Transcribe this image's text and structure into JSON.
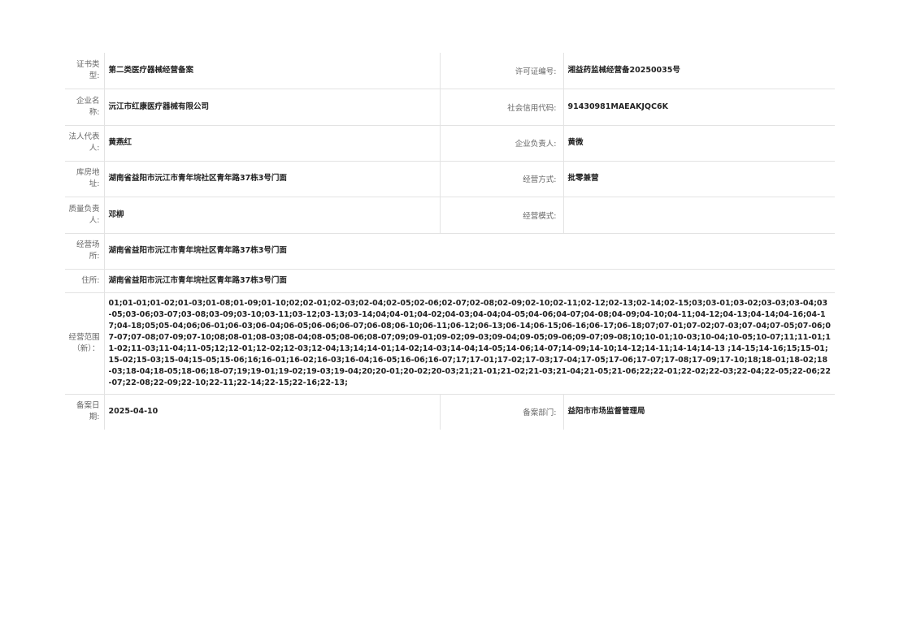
{
  "record": {
    "cert_type": {
      "label": "证书类型:",
      "value": "第二类医疗器械经营备案"
    },
    "license_no": {
      "label": "许可证编号:",
      "value": "湘益药监械经营备20250035号"
    },
    "company_name": {
      "label": "企业名称:",
      "value": "沅江市红康医疗器械有限公司"
    },
    "credit_code": {
      "label": "社会信用代码:",
      "value": "91430981MAEAKJQC6K"
    },
    "legal_rep": {
      "label": "法人代表人:",
      "value": "黄燕红"
    },
    "principal": {
      "label": "企业负责人:",
      "value": "黄微"
    },
    "warehouse": {
      "label": "库房地址:",
      "value": "湖南省益阳市沅江市青年垸社区青年路37栋3号门面"
    },
    "business_method": {
      "label": "经营方式:",
      "value": "批零兼营"
    },
    "quality_manager": {
      "label": "质量负责人:",
      "value": "邓柳"
    },
    "business_mode": {
      "label": "经营模式:",
      "value": ""
    },
    "business_premises": {
      "label": "经营场所:",
      "value": "湖南省益阳市沅江市青年垸社区青年路37栋3号门面"
    },
    "residence": {
      "label": "住所:",
      "value": "湖南省益阳市沅江市青年垸社区青年路37栋3号门面"
    },
    "scope": {
      "label": "经营范围（新）：",
      "value": "01;01-01;01-02;01-03;01-08;01-09;01-10;02;02-01;02-03;02-04;02-05;02-06;02-07;02-08;02-09;02-10;02-11;02-12;02-13;02-14;02-15;03;03-01;03-02;03-03;03-04;03-05;03-06;03-07;03-08;03-09;03-10;03-11;03-12;03-13;03-14;04;04-01;04-02;04-03;04-04;04-05;04-06;04-07;04-08;04-09;04-10;04-11;04-12;04-13;04-14;04-16;04-17;04-18;05;05-04;06;06-01;06-03;06-04;06-05;06-06;06-07;06-08;06-10;06-11;06-12;06-13;06-14;06-15;06-16;06-17;06-18;07;07-01;07-02;07-03;07-04;07-05;07-06;07-07;07-08;07-09;07-10;08;08-01;08-03;08-04;08-05;08-06;08-07;09;09-01;09-02;09-03;09-04;09-05;09-06;09-07;09-08;10;10-01;10-03;10-04;10-05;10-07;11;11-01;11-02;11-03;11-04;11-05;12;12-01;12-02;12-03;12-04;13;14;14-01;14-02;14-03;14-04;14-05;14-06;14-07;14-09;14-10;14-12;14-11;14-14;14-13 ;14-15;14-16;15;15-01;15-02;15-03;15-04;15-05;15-06;16;16-01;16-02;16-03;16-04;16-05;16-06;16-07;17;17-01;17-02;17-03;17-04;17-05;17-06;17-07;17-08;17-09;17-10;18;18-01;18-02;18-03;18-04;18-05;18-06;18-07;19;19-01;19-02;19-03;19-04;20;20-01;20-02;20-03;21;21-01;21-02;21-03;21-04;21-05;21-06;22;22-01;22-02;22-03;22-04;22-05;22-06;22-07;22-08;22-09;22-10;22-11;22-14;22-15;22-16;22-13;"
    },
    "filing_date": {
      "label": "备案日期:",
      "value": "2025-04-10"
    },
    "filing_dept": {
      "label": "备案部门:",
      "value": "益阳市市场监督管理局"
    }
  }
}
